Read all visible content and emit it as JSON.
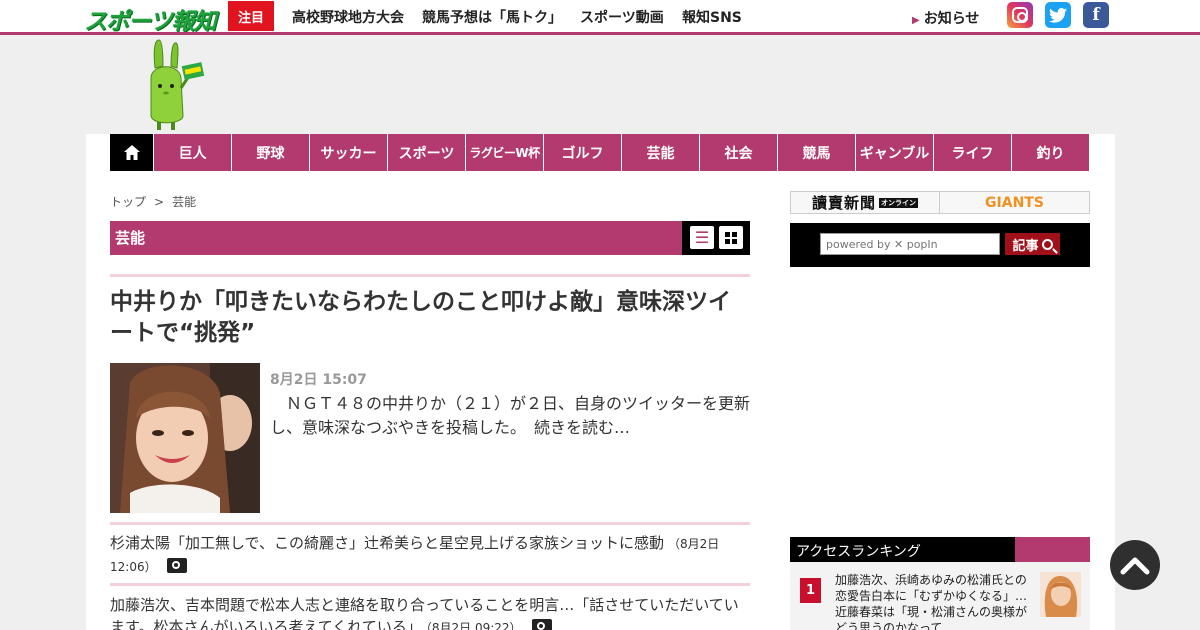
{
  "header": {
    "logo_text": "スポーツ報知",
    "featured_badge": "注目",
    "top_links": [
      "高校野球地方大会",
      "競馬予想は「馬トク」",
      "スポーツ動画",
      "報知SNS"
    ],
    "notice": "お知らせ",
    "sns_icons": [
      "instagram-icon",
      "twitter-icon",
      "facebook-icon"
    ]
  },
  "nav": {
    "items": [
      "巨人",
      "野球",
      "サッカー",
      "スポーツ",
      "ラグビーW杯",
      "ゴルフ",
      "芸能",
      "社会",
      "競馬",
      "ギャンブル",
      "ライフ",
      "釣り"
    ]
  },
  "breadcrumb": {
    "top": "トップ",
    "sep": ">",
    "current": "芸能"
  },
  "section": {
    "title": "芸能"
  },
  "headline": {
    "title": "中井りか「叩きたいならわたしのこと叩けよ敵」意味深ツイートで“挑発”",
    "date": "8月2日 15:07",
    "lead": "　ＮＧＴ４８の中井りか（２１）が２日、自身のツイッターを更新し、意味深なつぶやきを投稿した。　続きを読む…"
  },
  "articles": [
    {
      "title": "杉浦太陽「加工無しで、この綺麗さ」辻希美らと星空見上げる家族ショットに感動",
      "time": "（8月2日 12:06）"
    },
    {
      "title": "加藤浩次、吉本問題で松本人志と連絡を取り合っていることを明言…「話させていただいています。松本さんがいろいろ考えてくれている」",
      "time": "（8月2日 09:22）"
    }
  ],
  "sidebar": {
    "yomiuri_label": "讀賣新聞",
    "yomiuri_badge": "オンライン",
    "giants_label": "GIANTS",
    "search_placeholder": "powered by ✕ popIn",
    "search_button": "記事",
    "ranking_title": "アクセスランキング",
    "ranking": [
      {
        "rank": "1",
        "text": "加藤浩次、浜崎あゆみの松浦氏との恋愛告白本に「むずかゆくなる」…近藤春菜は「現・松浦さんの奥様がどう思うのかなって…"
      }
    ]
  },
  "colors": {
    "brand": "#b23a6e",
    "logo_green": "#1ea23c",
    "badge_red": "#e0141e"
  }
}
